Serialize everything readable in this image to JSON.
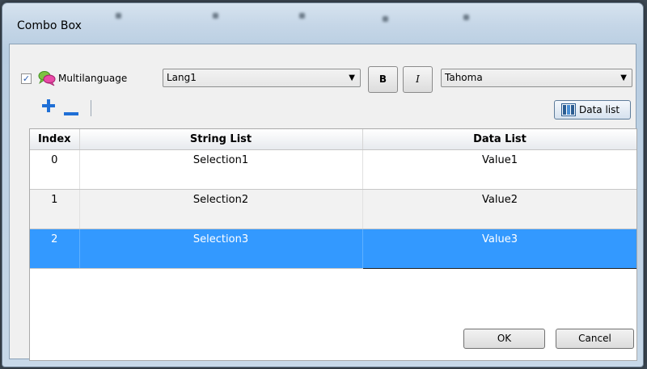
{
  "dialog": {
    "title": "Combo Box"
  },
  "toolbar": {
    "multilanguage_checked": true,
    "check_mark": "✓",
    "multilanguage_label": "Multilanguage",
    "language_value": "Lang1",
    "bold_label": "B",
    "italic_label": "I",
    "font_value": "Tahoma",
    "data_list_label": "Data list",
    "add_icon": "plus-icon",
    "remove_icon": "minus-icon"
  },
  "table": {
    "columns": [
      "Index",
      "String List",
      "Data List"
    ],
    "rows": [
      {
        "index": "0",
        "string": "Selection1",
        "data": "Value1",
        "selected": false
      },
      {
        "index": "1",
        "string": "Selection2",
        "data": "Value2",
        "selected": false
      },
      {
        "index": "2",
        "string": "Selection3",
        "data": "Value3",
        "selected": true
      }
    ]
  },
  "buttons": {
    "ok": "OK",
    "cancel": "Cancel"
  },
  "colors": {
    "selection": "#3399ff",
    "add_icon": "#1f6fd6",
    "remove_icon": "#1f6fd6"
  }
}
